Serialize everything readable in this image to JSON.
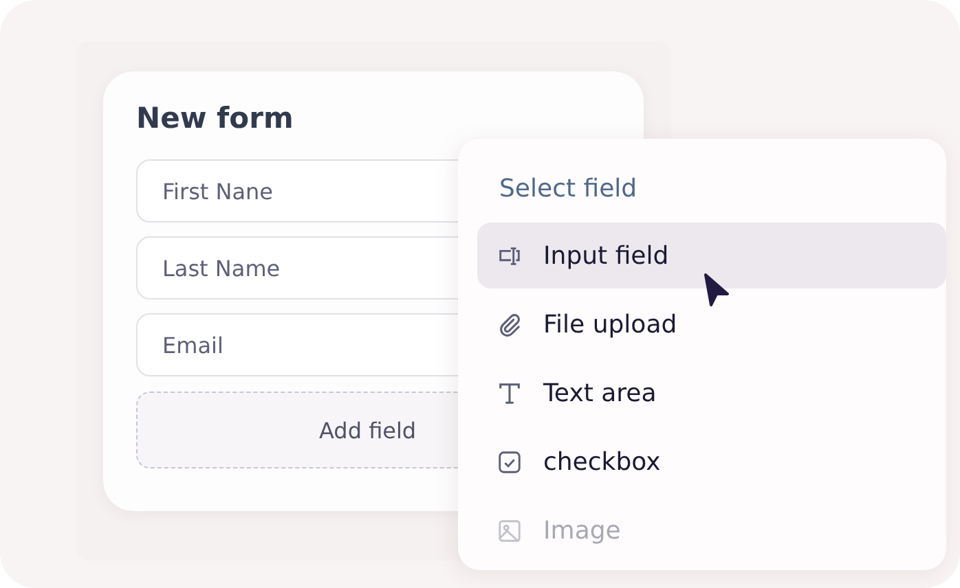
{
  "form": {
    "title": "New form",
    "fields": [
      {
        "placeholder": "First Nane"
      },
      {
        "placeholder": "Last Name"
      },
      {
        "placeholder": "Email"
      }
    ],
    "add_button": "Add field"
  },
  "menu": {
    "title": "Select field",
    "items": [
      {
        "kind": "input",
        "label": "Input field",
        "selected": true,
        "disabled": false
      },
      {
        "kind": "attachment",
        "label": "File upload",
        "selected": false,
        "disabled": false
      },
      {
        "kind": "text",
        "label": "Text area",
        "selected": false,
        "disabled": false
      },
      {
        "kind": "checkbox",
        "label": "checkbox",
        "selected": false,
        "disabled": false
      },
      {
        "kind": "image",
        "label": "Image",
        "selected": false,
        "disabled": true
      }
    ]
  }
}
